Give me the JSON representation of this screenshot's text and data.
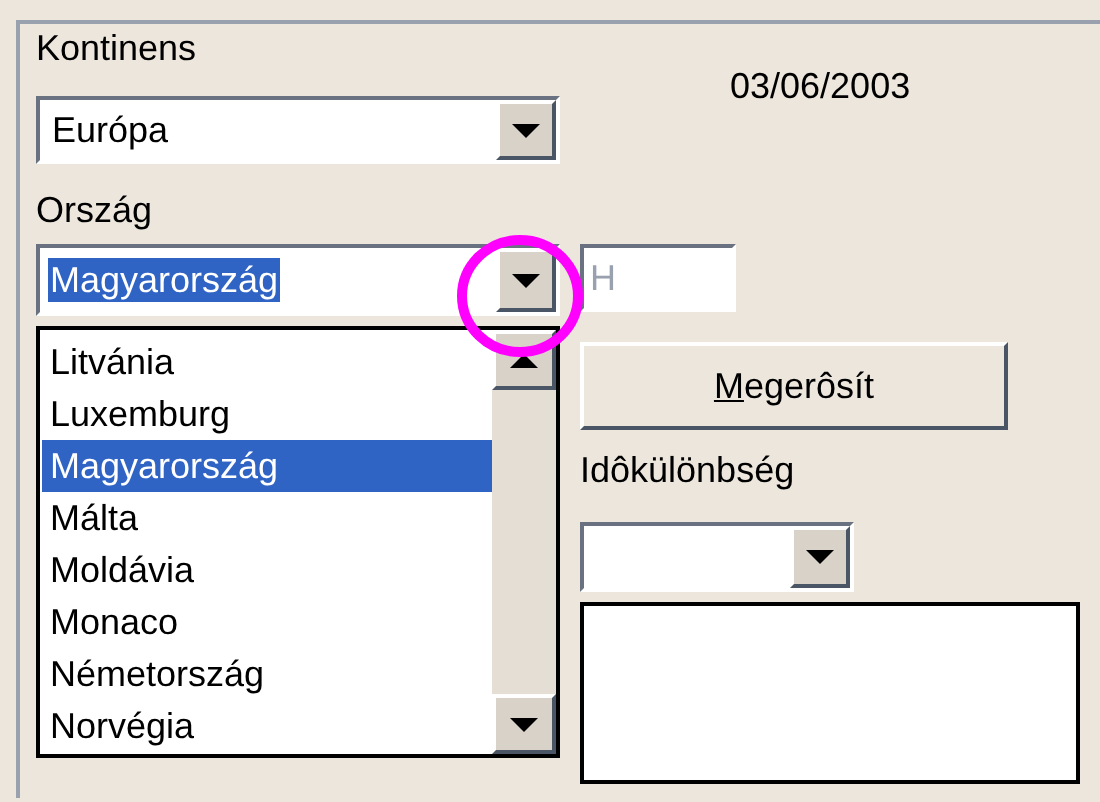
{
  "continent": {
    "label": "Kontinens",
    "value": "Európa"
  },
  "date": "03/06/2003",
  "country": {
    "label": "Ország",
    "value": "Magyarország",
    "value_selected": true,
    "expanded": true,
    "code": "H",
    "code_disabled": true
  },
  "country_list": [
    {
      "label": "Litvánia",
      "selected": false
    },
    {
      "label": "Luxemburg",
      "selected": false
    },
    {
      "label": "Magyarország",
      "selected": true
    },
    {
      "label": "Málta",
      "selected": false
    },
    {
      "label": "Moldávia",
      "selected": false
    },
    {
      "label": "Monaco",
      "selected": false
    },
    {
      "label": "Németország",
      "selected": false
    },
    {
      "label": "Norvégia",
      "selected": false
    }
  ],
  "confirm_button": {
    "label": "Megerôsít",
    "first_letter_underlined": true
  },
  "timezone": {
    "label": "Idôkülönbség"
  },
  "annotation": {
    "kind": "circle",
    "color": "#ff00ff"
  }
}
